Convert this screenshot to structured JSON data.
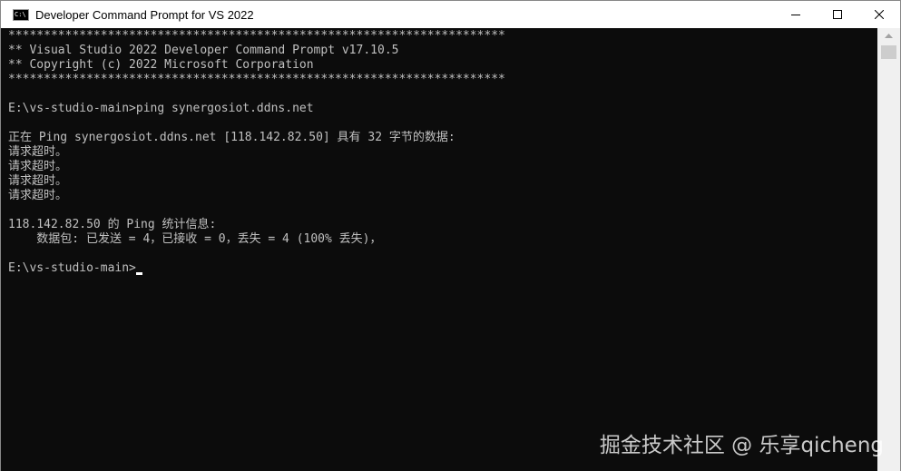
{
  "window": {
    "title": "Developer Command Prompt for VS 2022",
    "icon": "console-icon",
    "icon_text": "C:\\"
  },
  "console": {
    "lines": [
      "**********************************************************************",
      "** Visual Studio 2022 Developer Command Prompt v17.10.5",
      "** Copyright (c) 2022 Microsoft Corporation",
      "**********************************************************************",
      "",
      "E:\\vs-studio-main>ping synergosiot.ddns.net",
      "",
      "正在 Ping synergosiot.ddns.net [118.142.82.50] 具有 32 字节的数据:",
      "请求超时。",
      "请求超时。",
      "请求超时。",
      "请求超时。",
      "",
      "118.142.82.50 的 Ping 统计信息:",
      "    数据包: 已发送 = 4，已接收 = 0，丢失 = 4 (100% 丢失)，",
      ""
    ],
    "prompt": "E:\\vs-studio-main>",
    "text_color": "#c0c0c0",
    "background": "#0c0c0c"
  },
  "watermark": "掘金技术社区 @ 乐享qicheng"
}
